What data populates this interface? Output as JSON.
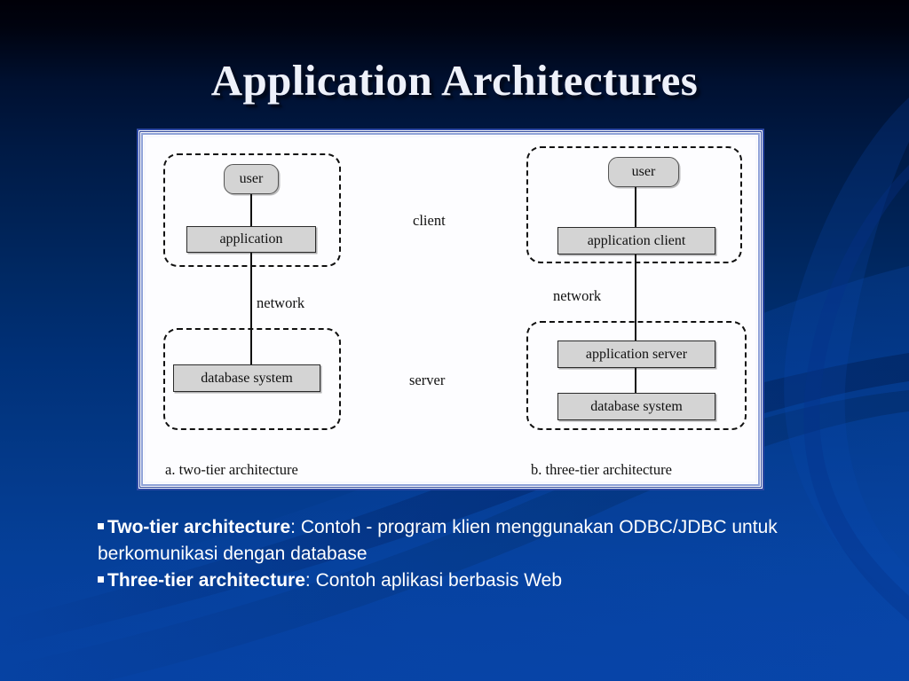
{
  "slide": {
    "title": "Application Architectures",
    "background_top_color": "#000008",
    "background_bottom_color": "#0642a3",
    "title_color": "#eef1fa"
  },
  "diagram": {
    "node_fill_color": "#d4d4d4",
    "panel_background": "#fdfdff",
    "frame_color": "#2f4aa5",
    "center_labels": {
      "client": "client",
      "server": "server"
    },
    "left": {
      "caption": "a.  two-tier architecture",
      "user": "user",
      "application": "application",
      "network": "network",
      "database_system": "database system"
    },
    "right": {
      "caption": "b.  three-tier architecture",
      "user": "user",
      "application_client": "application client",
      "network": "network",
      "application_server": "application server",
      "database_system": "database system"
    }
  },
  "bullets": [
    {
      "bold": "Two-tier architecture",
      "rest": ":  Contoh - program klien menggunakan ODBC/JDBC untuk berkomunikasi dengan database"
    },
    {
      "bold": "Three-tier architecture",
      "rest": ": Contoh aplikasi berbasis Web"
    }
  ]
}
